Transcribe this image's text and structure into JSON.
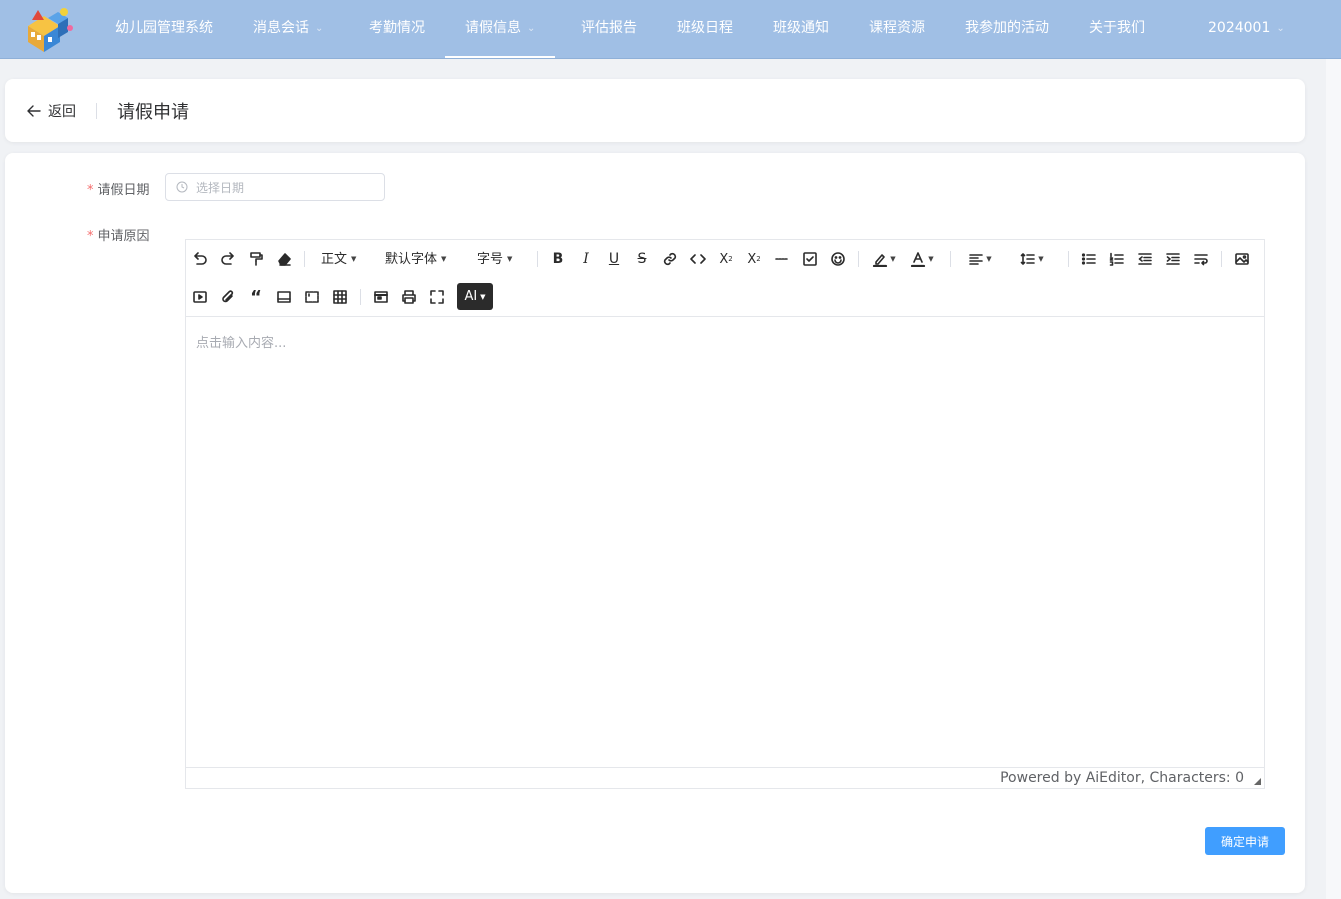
{
  "nav": {
    "brand": "幼儿园管理系统",
    "items": [
      {
        "label": "消息会话",
        "dropdown": true
      },
      {
        "label": "考勤情况",
        "dropdown": false
      },
      {
        "label": "请假信息",
        "dropdown": true,
        "active": true
      },
      {
        "label": "评估报告",
        "dropdown": false
      },
      {
        "label": "班级日程",
        "dropdown": false
      },
      {
        "label": "班级通知",
        "dropdown": false
      },
      {
        "label": "课程资源",
        "dropdown": false
      },
      {
        "label": "我参加的活动",
        "dropdown": false
      },
      {
        "label": "关于我们",
        "dropdown": false
      }
    ],
    "user": "2024001",
    "colors": {
      "bar": "#a0bfe5",
      "text": "#ffffff"
    }
  },
  "header": {
    "back_label": "返回",
    "title": "请假申请"
  },
  "form": {
    "date_label": "请假日期",
    "date_placeholder": "选择日期",
    "reason_label": "申请原因",
    "required_mark": "*",
    "submit_label": "确定申请",
    "accent": "#409eff"
  },
  "editor": {
    "toolbar_selects": {
      "paragraph": "正文",
      "font_family": "默认字体",
      "font_size": "字号"
    },
    "ai_label": "AI",
    "placeholder": "点击输入内容...",
    "footer": "Powered by AiEditor, Characters: 0",
    "toolbar_icons_row1": [
      "undo-icon",
      "redo-icon",
      "format-painter-icon",
      "eraser-icon",
      "bold-icon",
      "italic-icon",
      "underline-icon",
      "strikethrough-icon",
      "link-icon",
      "code-icon",
      "subscript-icon",
      "superscript-icon",
      "hr-icon",
      "todo-icon",
      "emoji-icon",
      "highlight-icon",
      "font-color-icon",
      "align-icon",
      "line-height-icon",
      "bullet-list-icon",
      "ordered-list-icon",
      "outdent-icon",
      "indent-icon",
      "break-icon",
      "image-icon"
    ],
    "toolbar_icons_row2": [
      "video-icon",
      "attachment-icon",
      "quote-icon",
      "container-icon",
      "code-block-icon",
      "table-icon",
      "source-code-icon",
      "print-icon",
      "fullscreen-icon"
    ]
  }
}
